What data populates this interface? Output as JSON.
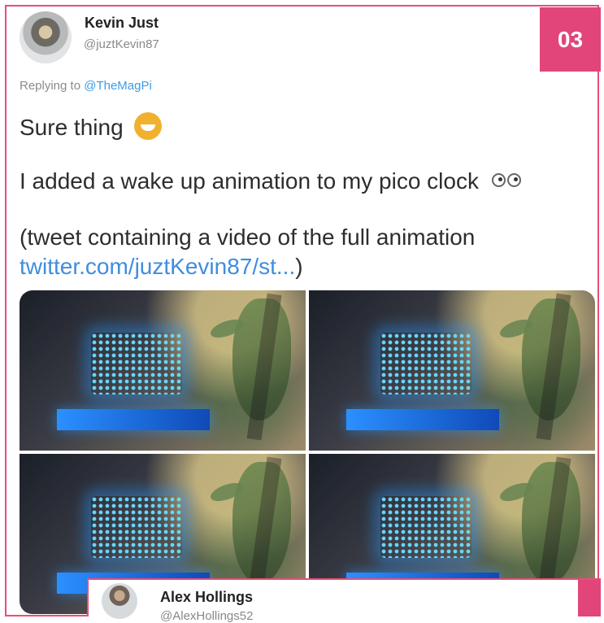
{
  "badge": {
    "number": "03"
  },
  "tweet": {
    "author_name": "Kevin Just",
    "author_handle": "@juztKevin87",
    "replying_prefix": "Replying to",
    "replying_handle": "@TheMagPi",
    "line1": "Sure thing",
    "line2": "I added a wake up animation to my pico clock",
    "line3": "(tweet containing a video of the full animation",
    "link": "twitter.com/juztKevin87/st...",
    "link_close": ")"
  },
  "next_tweet": {
    "author_name": "Alex Hollings",
    "author_handle": "@AlexHollings52"
  }
}
